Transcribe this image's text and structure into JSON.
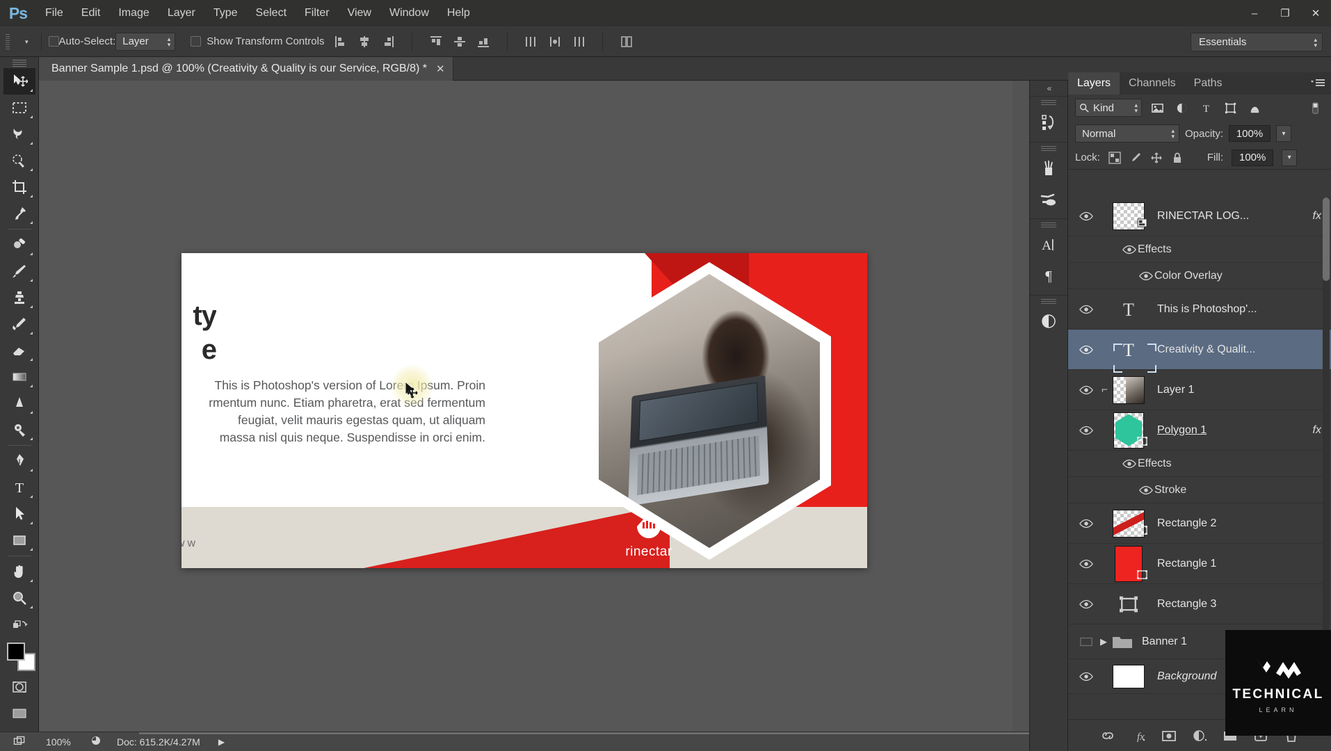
{
  "app": {
    "logo": "Ps",
    "title": "Adobe Photoshop"
  },
  "menubar": {
    "items": [
      "File",
      "Edit",
      "Image",
      "Layer",
      "Type",
      "Select",
      "Filter",
      "View",
      "Window",
      "Help"
    ],
    "window_controls": {
      "minimize": "–",
      "restore": "❐",
      "close": "✕"
    }
  },
  "options_bar": {
    "tool_icon": "move-tool-icon",
    "auto_select_label": "Auto-Select:",
    "auto_select_value": "Layer",
    "auto_select_checked": false,
    "show_transform_label": "Show Transform Controls",
    "show_transform_checked": false,
    "align_icons": [
      "align-left-edges-icon",
      "align-horizontal-centers-icon",
      "align-right-edges-icon",
      "align-top-edges-icon",
      "align-vertical-centers-icon",
      "align-bottom-edges-icon",
      "distribute-left-icon",
      "distribute-horizontal-center-icon",
      "distribute-right-icon",
      "distribute-top-icon",
      "distribute-vertical-center-icon",
      "distribute-bottom-icon",
      "3d-mode-icon"
    ],
    "workspace": "Essentials"
  },
  "document_tab": {
    "title": "Banner Sample 1.psd @ 100% (Creativity & Quality is our Service, RGB/8) *",
    "close": "✕"
  },
  "toolbar": {
    "tools": [
      {
        "name": "move-tool",
        "active": true
      },
      {
        "name": "rectangular-marquee-tool",
        "active": false
      },
      {
        "name": "lasso-tool",
        "active": false
      },
      {
        "name": "quick-selection-tool",
        "active": false
      },
      {
        "name": "crop-tool",
        "active": false
      },
      {
        "name": "eyedropper-tool",
        "active": false
      },
      {
        "name": "spot-healing-brush-tool",
        "active": false
      },
      {
        "name": "brush-tool",
        "active": false
      },
      {
        "name": "clone-stamp-tool",
        "active": false
      },
      {
        "name": "history-brush-tool",
        "active": false
      },
      {
        "name": "eraser-tool",
        "active": false
      },
      {
        "name": "gradient-tool",
        "active": false
      },
      {
        "name": "blur-tool",
        "active": false
      },
      {
        "name": "dodge-tool",
        "active": false
      },
      {
        "name": "pen-tool",
        "active": false
      },
      {
        "name": "horizontal-type-tool",
        "active": false
      },
      {
        "name": "path-selection-tool",
        "active": false
      },
      {
        "name": "rectangle-tool",
        "active": false
      },
      {
        "name": "hand-tool",
        "active": false
      },
      {
        "name": "zoom-tool",
        "active": false
      }
    ],
    "foreground_color": "#000000",
    "background_color": "#ffffff",
    "quick_mask": "edit-in-quick-mask-mode-icon"
  },
  "canvas": {
    "banner": {
      "headline_visible_fragment_line1": "ty",
      "headline_visible_fragment_line2": "e",
      "headline_full": "Creativity & Quality is our Service",
      "body_text": "This is Photoshop's version  of Lorem Ipsum. Proin rmentum nunc. Etiam pharetra, erat sed fermentum feugiat, velit mauris egestas quam, ut aliquam massa nisl quis neque. Suspendisse in orci enim.",
      "url": "www.rinectar.com",
      "logo_name": "rinectar",
      "logo_mark": "droplet-logo-icon",
      "colors": {
        "brand_red": "#e8201c",
        "dark_red": "#c01613",
        "bottom_bar": "#dedad1"
      }
    },
    "cursor": "move-cursor-icon"
  },
  "statusbar": {
    "arrange_icon": "arrange-documents-icon",
    "zoom": "100%",
    "clock_icon": "timing-icon",
    "doc_info": "Doc: 615.2K/4.27M",
    "more_arrow": "▶"
  },
  "dock_rail": {
    "collapse": "«",
    "groups": [
      {
        "icons": [
          "history-panel-icon"
        ]
      },
      {
        "icons": [
          "brush-panel-icon",
          "brush-presets-panel-icon"
        ]
      },
      {
        "icons": [
          "character-panel-icon",
          "paragraph-panel-icon"
        ]
      },
      {
        "icons": [
          "adjustments-panel-icon"
        ]
      }
    ]
  },
  "layers_panel": {
    "expand": "»",
    "tabs": [
      {
        "label": "Layers",
        "active": true
      },
      {
        "label": "Channels",
        "active": false
      },
      {
        "label": "Paths",
        "active": false
      }
    ],
    "menu_icon": "panel-menu-icon",
    "filter": {
      "search_icon": "search-icon",
      "kind_label": "Kind",
      "type_filters": [
        "filter-pixel-layers-icon",
        "filter-adjustment-layers-icon",
        "filter-type-layers-icon",
        "filter-shape-layers-icon",
        "filter-smart-object-icon"
      ],
      "toggle_icon": "filter-toggle-switch-icon"
    },
    "blend_mode": "Normal",
    "opacity_label": "Opacity:",
    "opacity_value": "100%",
    "lock_label": "Lock:",
    "lock_icons": [
      "lock-transparent-pixels-icon",
      "lock-image-pixels-icon",
      "lock-position-icon",
      "lock-all-icon"
    ],
    "fill_label": "Fill:",
    "fill_value": "100%",
    "layers": [
      {
        "name": "RINECTAR LOG...",
        "type": "smart-object",
        "visible": true,
        "selected": false,
        "has_fx": true,
        "fx_label": "fx",
        "thumb": "transparent-logo-thumb",
        "effects": {
          "label": "Effects",
          "items": [
            "Color Overlay"
          ]
        }
      },
      {
        "name": "This is Photoshop'...",
        "type": "text",
        "visible": true,
        "selected": false,
        "has_fx": false,
        "thumb": "type-thumb"
      },
      {
        "name": "Creativity & Qualit...",
        "type": "text",
        "visible": true,
        "selected": true,
        "has_fx": false,
        "thumb": "type-thumb"
      },
      {
        "name": "Layer 1",
        "type": "pixel",
        "visible": true,
        "selected": false,
        "has_fx": false,
        "clipped": true,
        "thumb": "photo-thumb"
      },
      {
        "name": "Polygon 1",
        "type": "shape",
        "visible": true,
        "selected": false,
        "has_fx": true,
        "fx_label": "fx",
        "underlined": true,
        "thumb": "teal-hexagon-thumb",
        "effects": {
          "label": "Effects",
          "items": [
            "Stroke"
          ]
        }
      },
      {
        "name": "Rectangle 2",
        "type": "shape",
        "visible": true,
        "selected": false,
        "has_fx": false,
        "thumb": "red-diagonal-thumb"
      },
      {
        "name": "Rectangle 1",
        "type": "shape",
        "visible": true,
        "selected": false,
        "has_fx": false,
        "thumb": "red-solid-thumb"
      },
      {
        "name": "Rectangle 3",
        "type": "shape",
        "visible": true,
        "selected": false,
        "has_fx": false,
        "thumb": "vector-mask-thumb"
      },
      {
        "name": "Banner 1",
        "type": "group",
        "visible": false,
        "selected": false,
        "has_fx": false,
        "thumb": "folder-thumb",
        "collapsed": true
      },
      {
        "name": "Background",
        "type": "background",
        "visible": true,
        "selected": false,
        "has_fx": false,
        "italic": true,
        "thumb": "white-thumb"
      }
    ],
    "footer_icons": [
      "link-layers-icon",
      "add-layer-style-icon",
      "add-layer-mask-icon",
      "new-fill-adjustment-layer-icon",
      "new-group-icon",
      "new-layer-icon",
      "delete-layer-icon"
    ]
  },
  "watermark": {
    "line1": "TECHNICAL",
    "line2": "LEARN",
    "mark": "w-logo-icon"
  }
}
